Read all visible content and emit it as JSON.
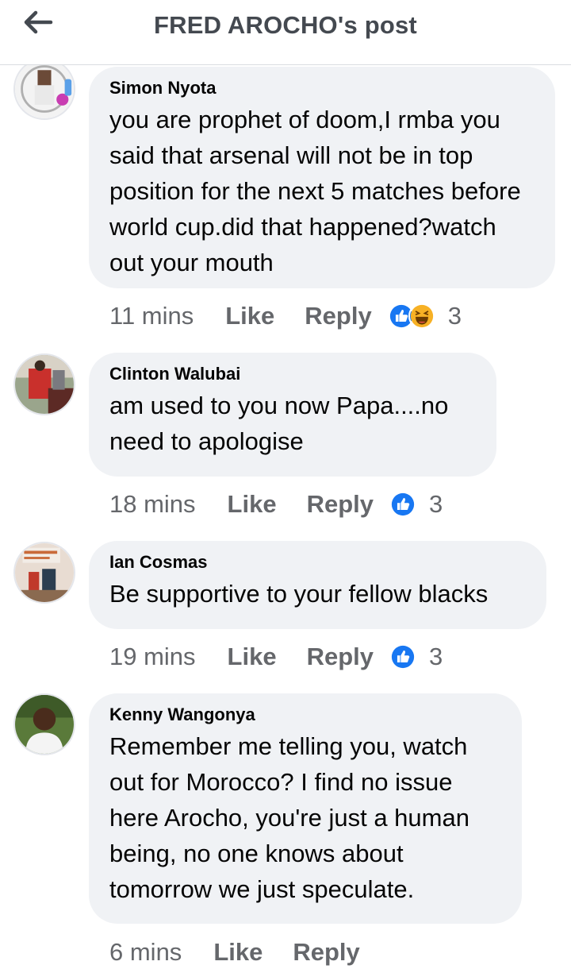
{
  "header": {
    "title": "FRED AROCHO's post",
    "back_icon": "arrow-left-icon"
  },
  "comments": [
    {
      "author": "Simon Nyota",
      "text": "you are prophet of doom,I rmba you said that arsenal will not be in top position for the next 5 matches before world cup.did that happened?watch out your mouth",
      "time": "11 mins",
      "like_label": "Like",
      "reply_label": "Reply",
      "reactions": [
        "like-icon",
        "haha-icon"
      ],
      "reaction_count": "3"
    },
    {
      "author": "Clinton Walubai",
      "text": "am used to you now Papa....no need to apologise",
      "time": "18 mins",
      "like_label": "Like",
      "reply_label": "Reply",
      "reactions": [
        "like-icon"
      ],
      "reaction_count": "3"
    },
    {
      "author": "Ian Cosmas",
      "text": "Be supportive to your fellow blacks",
      "time": "19 mins",
      "like_label": "Like",
      "reply_label": "Reply",
      "reactions": [
        "like-icon"
      ],
      "reaction_count": "3"
    },
    {
      "author": "Kenny Wangonya",
      "text": "Remember me telling you, watch out for Morocco? I find no issue here Arocho, you're just a human being, no one knows about tomorrow we just speculate.",
      "time": "6 mins",
      "like_label": "Like",
      "reply_label": "Reply",
      "reactions": [],
      "reaction_count": ""
    }
  ],
  "colors": {
    "bubble": "#f0f2f5",
    "meta_text": "#65676b",
    "like_blue": "#1877f2",
    "haha_yellow": "#f7b125"
  }
}
